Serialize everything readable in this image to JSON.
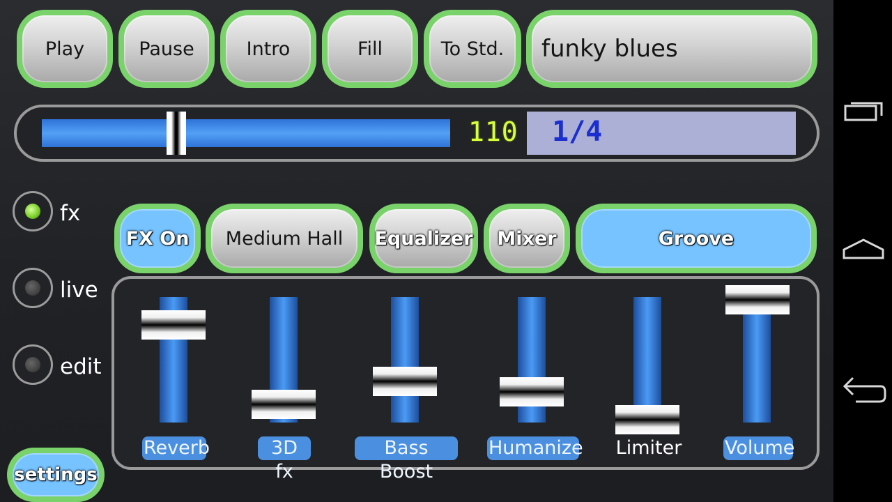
{
  "transport": {
    "play_label": "Play",
    "pause_label": "Pause",
    "intro_label": "Intro",
    "fill_label": "Fill",
    "to_std_label": "To Std.",
    "song_name": "funky blues"
  },
  "tempo": {
    "bpm": "110",
    "time_signature": "1/4",
    "slider_fraction": 0.32
  },
  "modes": [
    {
      "label": "fx",
      "selected": true
    },
    {
      "label": "live",
      "selected": false
    },
    {
      "label": "edit",
      "selected": false
    }
  ],
  "settings_label": "settings",
  "fx_bar": {
    "fx_on_label": "FX On",
    "reverb_type": "Medium Hall",
    "equalizer_label": "Equalizer",
    "mixer_label": "Mixer",
    "groove_label": "Groove"
  },
  "faders": [
    {
      "label": "Reverb",
      "level": 0.79,
      "enabled": true
    },
    {
      "label": "3D fx",
      "level": 0.13,
      "enabled": true
    },
    {
      "label": "Bass Boost",
      "level": 0.32,
      "enabled": true
    },
    {
      "label": "Humanize",
      "level": 0.23,
      "enabled": true
    },
    {
      "label": "Limiter",
      "level": 0.0,
      "enabled": false
    },
    {
      "label": "Volume",
      "level": 1.0,
      "enabled": true
    }
  ],
  "navbar": {
    "icons": [
      "recent-apps-icon",
      "home-icon",
      "back-icon"
    ]
  },
  "colors": {
    "accent_green": "#7ad36a",
    "accent_blue": "#76c3ff",
    "slider_blue": "#4a9bf5",
    "bpm_lcd": "#d8ff3c",
    "signature_lcd_bg": "#acafd6",
    "signature_lcd_text": "#1b2fd0"
  }
}
